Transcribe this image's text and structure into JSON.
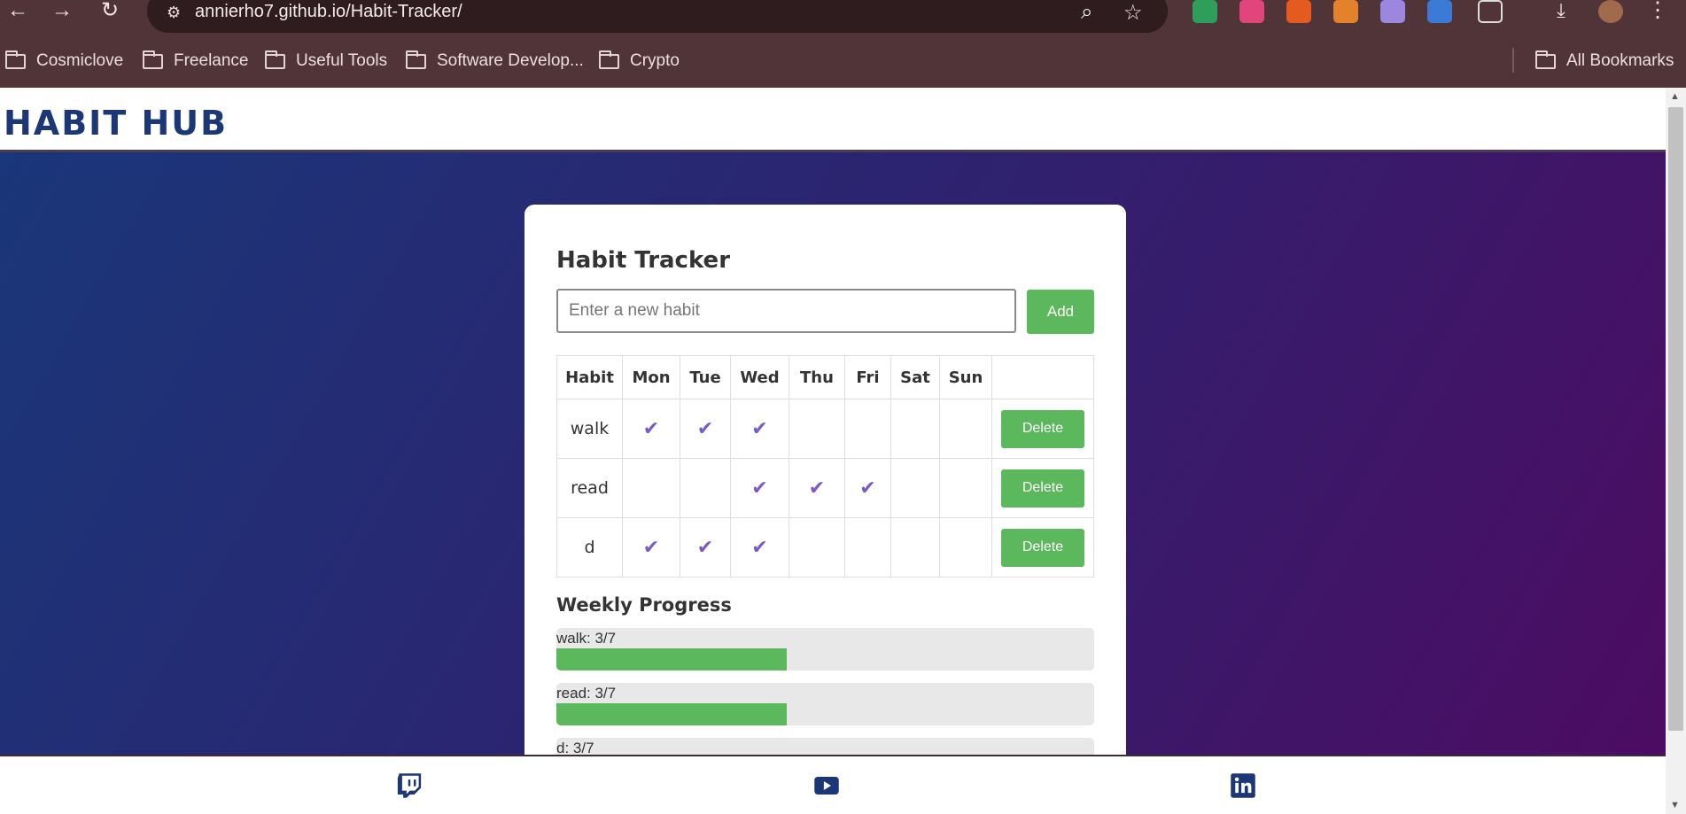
{
  "browser": {
    "url": "annierho7.github.io/Habit-Tracker/",
    "bookmarks": [
      "Cosmiclove",
      "Freelance",
      "Useful Tools",
      "Software Develop...",
      "Crypto"
    ],
    "all_bookmarks": "All Bookmarks"
  },
  "site": {
    "brand": "HABIT HUB"
  },
  "tracker": {
    "title": "Habit Tracker",
    "input_placeholder": "Enter a new habit",
    "add_label": "Add",
    "columns": [
      "Habit",
      "Mon",
      "Tue",
      "Wed",
      "Thu",
      "Fri",
      "Sat",
      "Sun",
      ""
    ],
    "rows": [
      {
        "habit": "walk",
        "days": [
          true,
          true,
          true,
          false,
          false,
          false,
          false
        ],
        "delete_label": "Delete"
      },
      {
        "habit": "read",
        "days": [
          false,
          false,
          true,
          true,
          true,
          false,
          false
        ],
        "delete_label": "Delete"
      },
      {
        "habit": "d",
        "days": [
          true,
          true,
          true,
          false,
          false,
          false,
          false
        ],
        "delete_label": "Delete"
      }
    ],
    "check_glyph": "✔"
  },
  "progress": {
    "title": "Weekly Progress",
    "items": [
      {
        "label": "walk: 3/7",
        "fraction": 0.4286
      },
      {
        "label": "read: 3/7",
        "fraction": 0.4286
      },
      {
        "label": "d: 3/7",
        "fraction": 0.4286
      }
    ]
  },
  "footer": {
    "links": [
      "twitch-icon",
      "youtube-icon",
      "linkedin-icon"
    ]
  },
  "colors": {
    "brand": "#1b3778",
    "accent_green": "#5cb85c",
    "check_purple": "#7a5ac8"
  }
}
